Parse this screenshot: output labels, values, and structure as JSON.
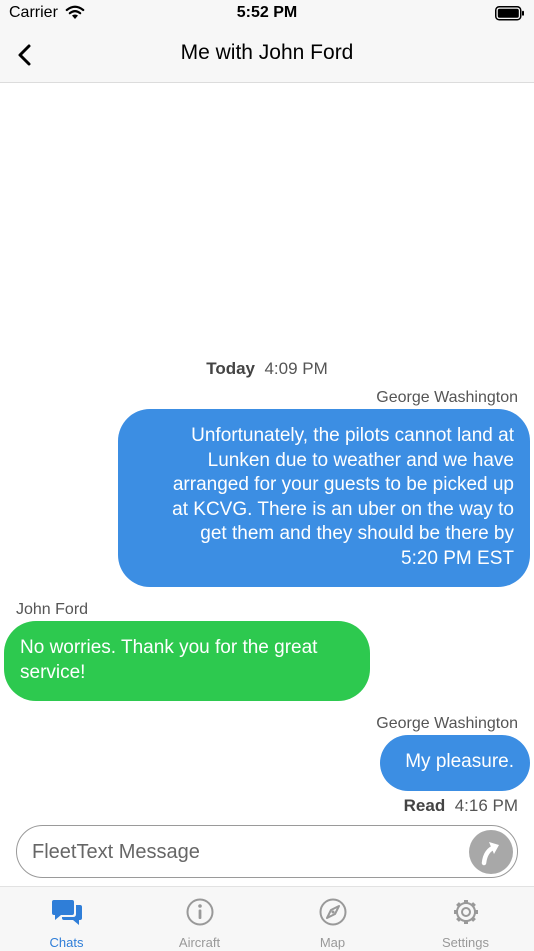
{
  "status_bar": {
    "carrier": "Carrier",
    "time": "5:52 PM"
  },
  "nav": {
    "title": "Me with John Ford"
  },
  "chat": {
    "date_header": {
      "day": "Today",
      "time": "4:09 PM"
    },
    "messages": [
      {
        "sender": "George Washington",
        "direction": "outgoing",
        "lines": [
          "Unfortunately, the pilots cannot land at",
          "Lunken due to weather and we have",
          "arranged for your guests to be picked up",
          "at KCVG. There is an uber on the way to",
          "get them and they should be there by",
          "5:20 PM EST"
        ]
      },
      {
        "sender": "John Ford",
        "direction": "incoming",
        "lines": [
          "No worries. Thank you for the great",
          "service!"
        ]
      },
      {
        "sender": "George Washington",
        "direction": "outgoing",
        "lines": [
          "My pleasure."
        ]
      }
    ],
    "read_receipt": {
      "status": "Read",
      "time": "4:16 PM"
    }
  },
  "composer": {
    "placeholder": "FleetText Message",
    "value": ""
  },
  "tabs": [
    {
      "label": "Chats",
      "icon": "chat-bubbles-icon",
      "active": true
    },
    {
      "label": "Aircraft",
      "icon": "info-circle-icon",
      "active": false
    },
    {
      "label": "Map",
      "icon": "compass-icon",
      "active": false
    },
    {
      "label": "Settings",
      "icon": "gear-icon",
      "active": false
    }
  ],
  "colors": {
    "outgoing_bubble": "#3c8ee3",
    "incoming_bubble": "#2dc94f",
    "active_tab": "#2f7ed8",
    "inactive_tab": "#999999"
  }
}
